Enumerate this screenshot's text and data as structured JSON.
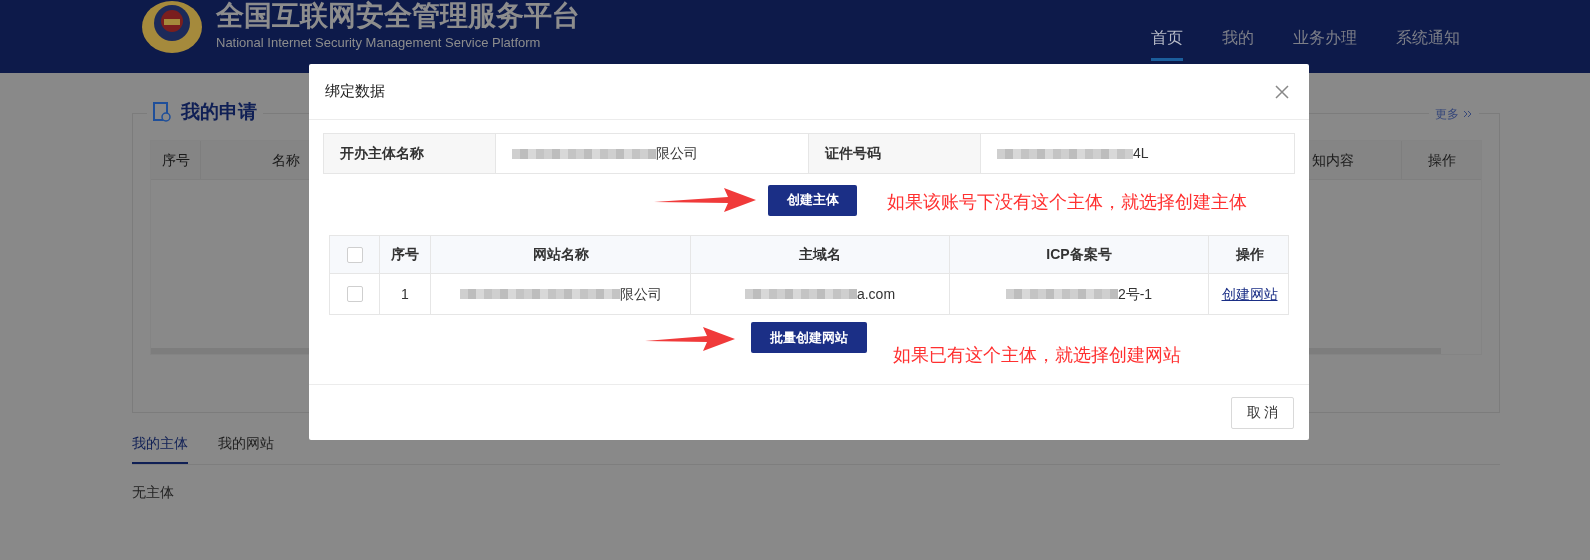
{
  "header": {
    "title": "全国互联网安全管理服务平台",
    "subtitle": "National Internet Security Management Service Platform",
    "nav": [
      {
        "label": "首页",
        "selected": true
      },
      {
        "label": "我的",
        "selected": false
      },
      {
        "label": "业务办理",
        "selected": false
      },
      {
        "label": "系统通知",
        "selected": false
      }
    ]
  },
  "applications": {
    "title": "我的申请",
    "more": "更多",
    "left_columns": [
      "序号",
      "名称"
    ],
    "right_columns": [
      "知内容",
      "操作"
    ]
  },
  "tabs": [
    {
      "label": "我的主体",
      "selected": true
    },
    {
      "label": "我的网站",
      "selected": false
    }
  ],
  "empty_text": "无主体",
  "dialog": {
    "title": "绑定数据",
    "info": [
      {
        "label": "开办主体名称",
        "value": "限公司",
        "redacted": true
      },
      {
        "label": "证件号码",
        "value": "4L",
        "redacted": true
      }
    ],
    "create_subject_button": "创建主体",
    "subject_hint": "如果该账号下没有这个主体，就选择创建主体",
    "table": {
      "header_checked": false,
      "columns": [
        "序号",
        "网站名称",
        "主域名",
        "ICP备案号",
        "操作"
      ],
      "rows": [
        {
          "checked": false,
          "cells": [
            {
              "text": "1",
              "redacted": false
            },
            {
              "text": "限公司",
              "redacted": true
            },
            {
              "text": "a.com",
              "redacted": true
            },
            {
              "text": "2号-1",
              "redacted": true
            }
          ],
          "action": "创建网站"
        }
      ]
    },
    "batch_button": "批量创建网站",
    "site_hint": "如果已有这个主体，就选择创建网站",
    "cancel_button": "取 消"
  }
}
